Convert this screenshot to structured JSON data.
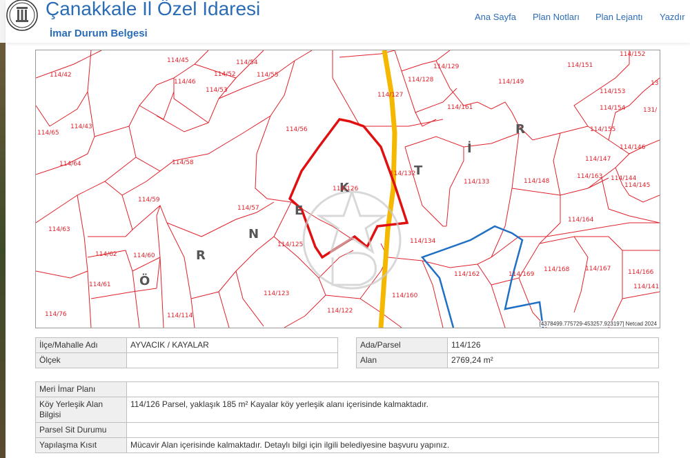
{
  "header": {
    "title": "Çanakkale İl Özel İdaresi",
    "subtitle": "İmar Durum Belgesi",
    "nav": [
      "Ana Sayfa",
      "Plan Notları",
      "Plan Lejantı",
      "Yazdır"
    ]
  },
  "map": {
    "parcel_labels": [
      "114/42",
      "114/45",
      "114/46",
      "114/52",
      "114/53",
      "114/54",
      "114/55",
      "114/56",
      "114/127",
      "114/128",
      "114/129",
      "114/149",
      "114/151",
      "114/152",
      "114/65",
      "114/43",
      "114/64",
      "114/58",
      "114/59",
      "114/57",
      "114/63",
      "114/62",
      "114/60",
      "114/61",
      "114/76",
      "114/114",
      "114/123",
      "114/122",
      "114/125",
      "114/126",
      "114/132",
      "114/133",
      "114/134",
      "114/148",
      "114/160",
      "114/161",
      "114/162",
      "114/169",
      "114/168",
      "114/167",
      "114/166",
      "114/141",
      "114/164",
      "114/163",
      "114/144",
      "114/145",
      "114/147",
      "114/146",
      "114/155",
      "114/154",
      "114/153",
      "131/",
      "13"
    ],
    "district_letters": [
      "Ö",
      "R",
      "N",
      "E",
      "K",
      "T",
      "İ",
      "R"
    ],
    "footer": "[4378499.775729-453257.923197] Netcad 2024",
    "colors": {
      "parcel_lines": "#e0202a",
      "selected_parcel": "#e01010",
      "road": "#f5b800",
      "boundary": "#1f6fc4"
    }
  },
  "info_left": [
    {
      "label": "İlçe/Mahalle Adı",
      "value": "AYVACIK / KAYALAR"
    },
    {
      "label": "Ölçek",
      "value": ""
    }
  ],
  "info_right": [
    {
      "label": "Ada/Parsel",
      "value": "114/126"
    },
    {
      "label": "Alan",
      "value": "2769,24 m²"
    }
  ],
  "info_main": [
    {
      "label": "Meri İmar Planı",
      "value": ""
    },
    {
      "label": "Köy Yerleşik Alan Bilgisi",
      "value": "114/126 Parsel, yaklaşık 185 m² Kayalar köy yerleşik alanı içerisinde kalmaktadır."
    },
    {
      "label": "Parsel Sit Durumu",
      "value": ""
    },
    {
      "label": "Yapılaşma Kısıt",
      "value": "Mücavir Alan içerisinde kalmaktadır. Detaylı bilgi için ilgili belediyesine başvuru yapınız."
    }
  ]
}
